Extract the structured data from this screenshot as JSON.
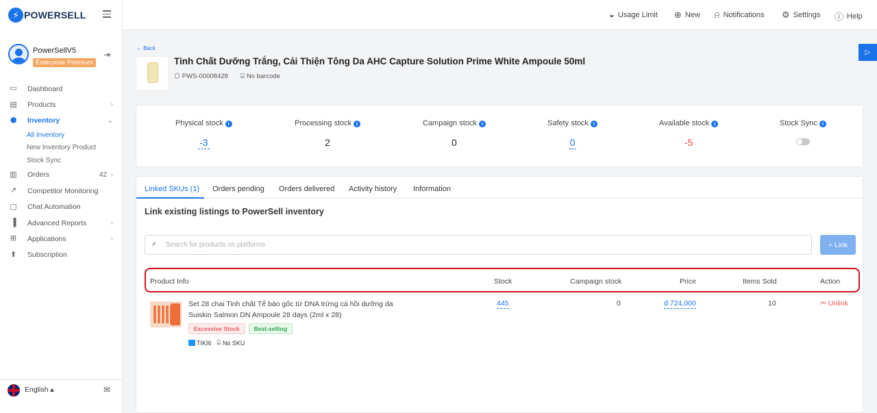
{
  "brand": {
    "logo_mark": "⚡",
    "name": "POWERSELL"
  },
  "user": {
    "name": "PowerSellV5",
    "plan": "Enterprise Premium"
  },
  "sidebar": {
    "items": [
      {
        "label": "Dashboard",
        "icon": "monitor-icon"
      },
      {
        "label": "Products",
        "icon": "box-icon"
      },
      {
        "label": "Inventory",
        "icon": "cube-icon"
      },
      {
        "label": "Orders",
        "icon": "clipboard-icon",
        "count": "42"
      },
      {
        "label": "Competitor Monitoring",
        "icon": "trend-icon"
      },
      {
        "label": "Chat Automation",
        "icon": "chat-icon"
      },
      {
        "label": "Advanced Reports",
        "icon": "bar-chart-icon"
      },
      {
        "label": "Applications",
        "icon": "grid-icon"
      },
      {
        "label": "Subscription",
        "icon": "arrow-up-circle-icon"
      }
    ],
    "inventory_sub": [
      "All Inventory",
      "New Inventory Product",
      "Stock Sync"
    ],
    "language": "English"
  },
  "topbar": {
    "usage_limit": "Usage Limit",
    "new": "New",
    "notifications": "Notifications",
    "settings": "Settings",
    "help": "Help"
  },
  "product": {
    "back": "← Back",
    "title": "Tinh Chất Dưỡng Trắng, Cải Thiện Tông Da AHC Capture Solution Prime White Ampoule 50ml",
    "sku": "PWS-00008428",
    "barcode": "No barcode"
  },
  "stock": {
    "physical": {
      "label": "Physical stock",
      "value": "-3"
    },
    "processing": {
      "label": "Processing stock",
      "value": "2"
    },
    "campaign": {
      "label": "Campaign stock",
      "value": "0"
    },
    "safety": {
      "label": "Safety stock",
      "value": "0"
    },
    "available": {
      "label": "Available stock",
      "value": "-5"
    },
    "sync": {
      "label": "Stock Sync",
      "enabled": false
    }
  },
  "tabs": [
    "Linked SKUs (1)",
    "Orders pending",
    "Orders delivered",
    "Activity history",
    "Information"
  ],
  "linked": {
    "title": "Link existing listings to PowerSell inventory",
    "search_placeholder": "Search for products on platforms",
    "link_button": "+ Link",
    "columns": [
      "Product Info",
      "Stock",
      "Campaign stock",
      "Price",
      "Items Sold",
      "Action"
    ],
    "rows": [
      {
        "name": "Set 28 chai Tinh chất Tế bào gốc từ DNA trứng cá hồi dưỡng da Suiskin Salmon DN Ampoule 28 days (2ml x 28)",
        "tags": [
          "Excessive Stock",
          "Best-selling"
        ],
        "shop": "TIKI6",
        "sku": "No SKU",
        "stock": "445",
        "campaign_stock": "0",
        "price": "đ 724,000",
        "items_sold": "10",
        "action": "Unlink"
      }
    ]
  },
  "colors": {
    "accent": "#1a73e8",
    "danger": "#e44444",
    "plan_badge": "#f4a55e",
    "highlight_border": "#d0101a"
  }
}
